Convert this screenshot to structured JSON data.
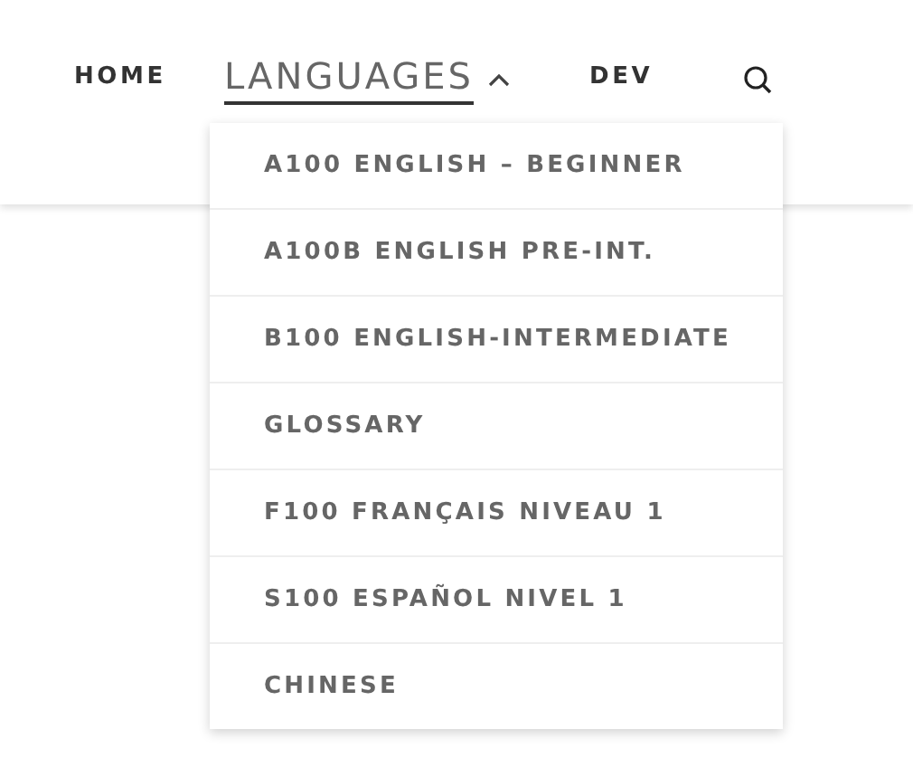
{
  "nav": [
    {
      "label": "HOME",
      "selected": false
    },
    {
      "label": "LANGUAGES",
      "selected": true,
      "expanded": true
    },
    {
      "label": "DEV",
      "selected": false
    }
  ],
  "dropdown": [
    {
      "label": "A100 ENGLISH – BEGINNER"
    },
    {
      "label": "A100B ENGLISH PRE-INT."
    },
    {
      "label": "B100 ENGLISH-INTERMEDIATE"
    },
    {
      "label": "GLOSSARY"
    },
    {
      "label": "F100 FRANÇAIS NIVEAU 1"
    },
    {
      "label": "S100 ESPAÑOL NIVEL 1"
    },
    {
      "label": "CHINESE"
    }
  ]
}
